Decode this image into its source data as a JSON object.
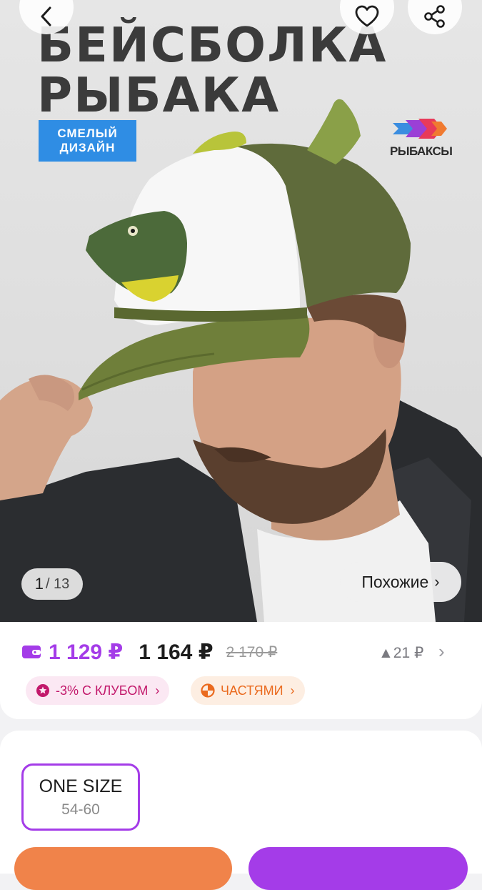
{
  "hero": {
    "title_line1": "БЕЙСБОЛКА",
    "title_line2": "РЫБАКА",
    "badge_line1": "СМЕЛЫЙ",
    "badge_line2": "ДИЗАЙН",
    "brand": "РЫБАКСЫ",
    "counter_current": "1",
    "counter_total": "/ 13",
    "similar_label": "Похожие",
    "similar_chevron": "›"
  },
  "toolbar": {
    "back_icon": "chevron-left-icon",
    "favorite_icon": "heart-icon",
    "share_icon": "share-icon"
  },
  "price": {
    "club_price": "1 129 ₽",
    "price": "1 164 ₽",
    "old_price": "2 170 ₽",
    "delta": "▲21 ₽",
    "delta_chevron": "›",
    "club_chip": "-3% С КЛУБОМ",
    "parts_chip": "ЧАСТЯМИ",
    "chip_chevron": "›"
  },
  "sizes": {
    "selected_name": "ONE SIZE",
    "selected_range": "54-60"
  },
  "colors": {
    "accent_purple": "#a43ce8",
    "club_pink": "#c2186b",
    "parts_orange": "#ea6a1e",
    "cart_orange": "#f0834a",
    "badge_blue": "#2f8de4"
  }
}
